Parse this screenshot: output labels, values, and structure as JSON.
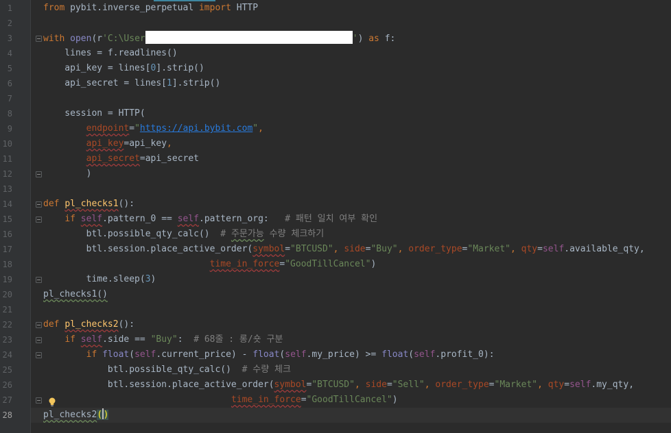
{
  "gutter": {
    "line_numbers": [
      "1",
      "2",
      "3",
      "4",
      "5",
      "6",
      "7",
      "8",
      "9",
      "10",
      "11",
      "12",
      "13",
      "14",
      "15",
      "16",
      "17",
      "18",
      "19",
      "20",
      "21",
      "22",
      "23",
      "24",
      "25",
      "26",
      "27",
      "28"
    ]
  },
  "code": {
    "l1": [
      "from",
      " pybit.inverse_perpetual ",
      "import",
      " HTTP"
    ],
    "l3": [
      "with",
      " ",
      "open",
      "(r",
      "'C:\\User",
      "'",
      ") ",
      "as",
      " f:"
    ],
    "l4": [
      "    lines = f.readlines()"
    ],
    "l5": [
      "    api_key = lines[",
      "0",
      "].strip()"
    ],
    "l6": [
      "    api_secret = lines[",
      "1",
      "].strip()"
    ],
    "l8": [
      "    session = HTTP("
    ],
    "l9": [
      "        ",
      "endpoint",
      "=",
      "\"",
      "https://api.bybit.com",
      "\"",
      ","
    ],
    "l10": [
      "        ",
      "api_key",
      "=api_key",
      ","
    ],
    "l11": [
      "        ",
      "api_secret",
      "=api_secret"
    ],
    "l12": [
      "        )"
    ],
    "l14": [
      "def",
      " ",
      "pl_checks1",
      "():"
    ],
    "l15": [
      "    ",
      "if",
      " ",
      "self",
      ".pattern_0 == ",
      "self",
      ".pattern_org:   ",
      "# 패턴 일치 여부 확인"
    ],
    "l16": [
      "        btl.possible_qty_calc()  ",
      "# ",
      "주문가능",
      " 수량 체크하기"
    ],
    "l17": [
      "        btl.session.place_active_order(",
      "symbol",
      "=",
      "\"BTCUSD\"",
      ", ",
      "side",
      "=",
      "\"Buy\"",
      ", ",
      "order_type",
      "=",
      "\"Market\"",
      ", ",
      "qty",
      "=",
      "self",
      ".available_qty,"
    ],
    "l18": [
      "                               ",
      "time_in_force",
      "=",
      "\"GoodTillCancel\"",
      ")"
    ],
    "l19": [
      "        time.sleep(",
      "3",
      ")"
    ],
    "l20": [
      "pl_checks1()"
    ],
    "l22": [
      "def",
      " ",
      "pl_checks2",
      "():"
    ],
    "l23": [
      "    ",
      "if",
      " ",
      "self",
      ".side == ",
      "\"Buy\"",
      ":  ",
      "# 68줄 : 롱/숏 구분"
    ],
    "l24": [
      "        ",
      "if",
      " ",
      "float",
      "(",
      "self",
      ".current_price) - ",
      "float",
      "(",
      "self",
      ".my_price) >= ",
      "float",
      "(",
      "self",
      ".profit_0):"
    ],
    "l25": [
      "            btl.possible_qty_calc()  ",
      "# 수량 체크"
    ],
    "l26": [
      "            btl.session.place_active_order(",
      "symbol",
      "=",
      "\"BTCUSD\"",
      ", ",
      "side",
      "=",
      "\"Sell\"",
      ", ",
      "order_type",
      "=",
      "\"Market\"",
      ", ",
      "qty",
      "=",
      "self",
      ".my_qty,"
    ],
    "l27": [
      "                                   ",
      "time_in_force",
      "=",
      "\"GoodTillCancel\"",
      ")"
    ],
    "l28": [
      "pl_checks2",
      "(",
      ")"
    ]
  },
  "icons": {
    "fold": "fold-marker-icon",
    "intention": "lightbulb-icon"
  },
  "colors": {
    "background": "#2b2b2b",
    "keyword": "#cc7832",
    "function": "#ffc66d",
    "string": "#6a8759",
    "number": "#6897bb",
    "param": "#aa4926",
    "comment": "#808080",
    "self": "#94558d"
  }
}
